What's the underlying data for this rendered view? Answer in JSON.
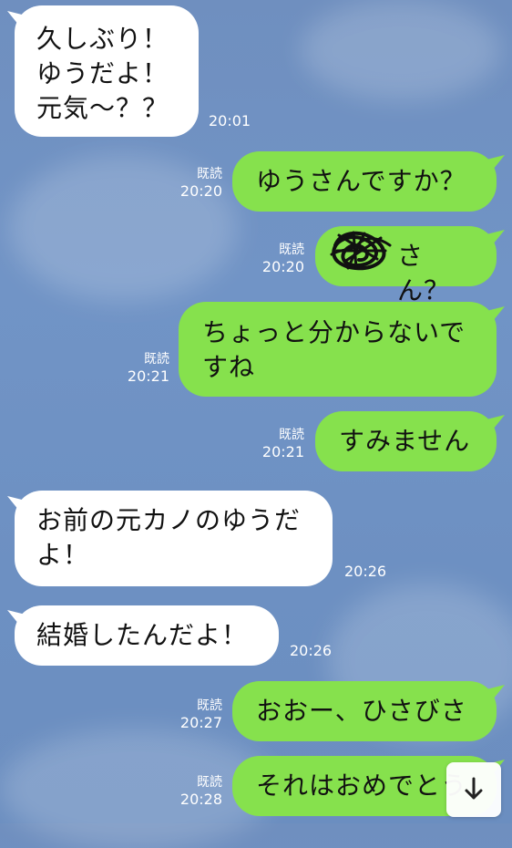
{
  "theme": {
    "background": "#6f8fbf",
    "incoming_bubble": "#ffffff",
    "outgoing_bubble": "#86e14d",
    "meta_text": "#ffffff"
  },
  "messages": [
    {
      "direction": "incoming",
      "text": "久しぶり！\nゆうだよ！\n元気〜？？",
      "time": "20:01"
    },
    {
      "direction": "outgoing",
      "text": "ゆうさんですか？",
      "read": "既読",
      "time": "20:20"
    },
    {
      "direction": "outgoing",
      "text": "さん？",
      "read": "既読",
      "time": "20:20"
    },
    {
      "direction": "outgoing",
      "text": "ちょっと分からないで\nすね",
      "read": "既読",
      "time": "20:21"
    },
    {
      "direction": "outgoing",
      "text": "すみません",
      "read": "既読",
      "time": "20:21"
    },
    {
      "direction": "incoming",
      "text": "お前の元カノのゆうだ\nよ！",
      "time": "20:26"
    },
    {
      "direction": "incoming",
      "text": "結婚したんだよ！",
      "time": "20:26"
    },
    {
      "direction": "outgoing",
      "text": "おおー、ひさびさ",
      "read": "既読",
      "time": "20:27"
    },
    {
      "direction": "outgoing",
      "text": "それはおめでとう",
      "read": "既読",
      "time": "20:28"
    }
  ],
  "scroll_button": {
    "icon": "arrow-down-icon"
  }
}
